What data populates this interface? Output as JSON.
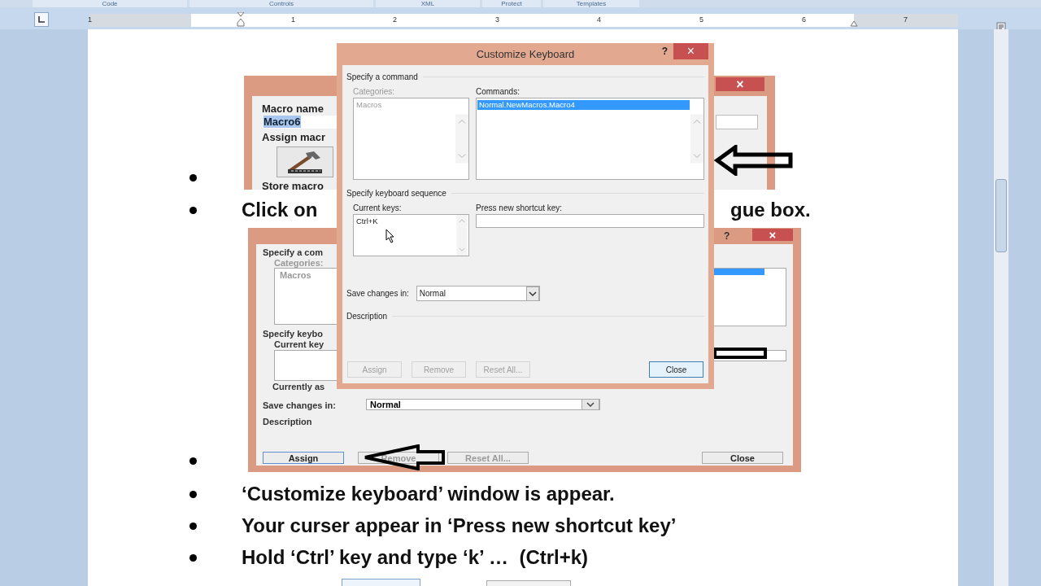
{
  "ribbon_groups": [
    "Code",
    "Controls",
    "XML",
    "Protect",
    "Templates"
  ],
  "ruler": {
    "numbers": [
      "1",
      "1",
      "2",
      "3",
      "4",
      "5",
      "6",
      "7"
    ]
  },
  "document": {
    "bullets": [
      {
        "kind": "empty"
      },
      {
        "kind": "split",
        "left": "Click on",
        "right": "gue box."
      },
      {
        "kind": "empty"
      },
      {
        "kind": "text",
        "text": "‘Customize keyboard’ window is appear."
      },
      {
        "kind": "text",
        "text": "Your curser appear in ‘Press new shortcut key’"
      },
      {
        "kind": "text",
        "text": "Hold ‘Ctrl’ key and type ‘k’ …  (Ctrl+k)"
      }
    ],
    "record_macro_figure": {
      "close": "×",
      "macro_name_label": "Macro name",
      "macro_name": {
        "value": "Macro6",
        "selected": true
      },
      "assign_label": "Assign macr",
      "store_label": "Store macro"
    },
    "keyboard_figure": {
      "help": "?",
      "close": "×",
      "command_label": "Specify a com",
      "categories_label": "Categories:",
      "category": "Macros",
      "sequence_label": "Specify keybo",
      "current_keys_label": "Current key",
      "currently_label": "Currently as",
      "save_label": "Save changes in:",
      "save_in": "Normal",
      "description_label": "Description",
      "buttons": [
        {
          "label": "Assign",
          "disabled": false
        },
        {
          "label": "Remove",
          "disabled": true
        },
        {
          "label": "Reset All...",
          "disabled": true
        },
        {
          "label": "Close",
          "disabled": false
        }
      ]
    }
  },
  "dialog": {
    "title": "Customize Keyboard",
    "help": "?",
    "close": "×",
    "command_section": "Specify a command",
    "categories": {
      "label": "Categories:",
      "disabled": true,
      "items": [
        {
          "text": "Macros",
          "selected": false
        }
      ]
    },
    "commands": {
      "label": "Commands:",
      "disabled": false,
      "items": [
        {
          "text": "Normal.NewMacros.Macro4",
          "selected": true
        }
      ]
    },
    "sequence_section": "Specify keyboard sequence",
    "current_keys": {
      "label": "Current keys:",
      "items": [
        {
          "text": "Ctrl+K",
          "selected": false
        }
      ]
    },
    "new_shortcut": {
      "label": "Press new shortcut key:"
    },
    "save_in": {
      "label": "Save changes in:",
      "value": "Normal"
    },
    "description_section": "Description",
    "buttons": [
      {
        "label": "Assign",
        "disabled": true
      },
      {
        "label": "Remove",
        "disabled": true
      },
      {
        "label": "Reset All...",
        "disabled": true
      },
      {
        "label": "Close",
        "disabled": false
      }
    ]
  }
}
